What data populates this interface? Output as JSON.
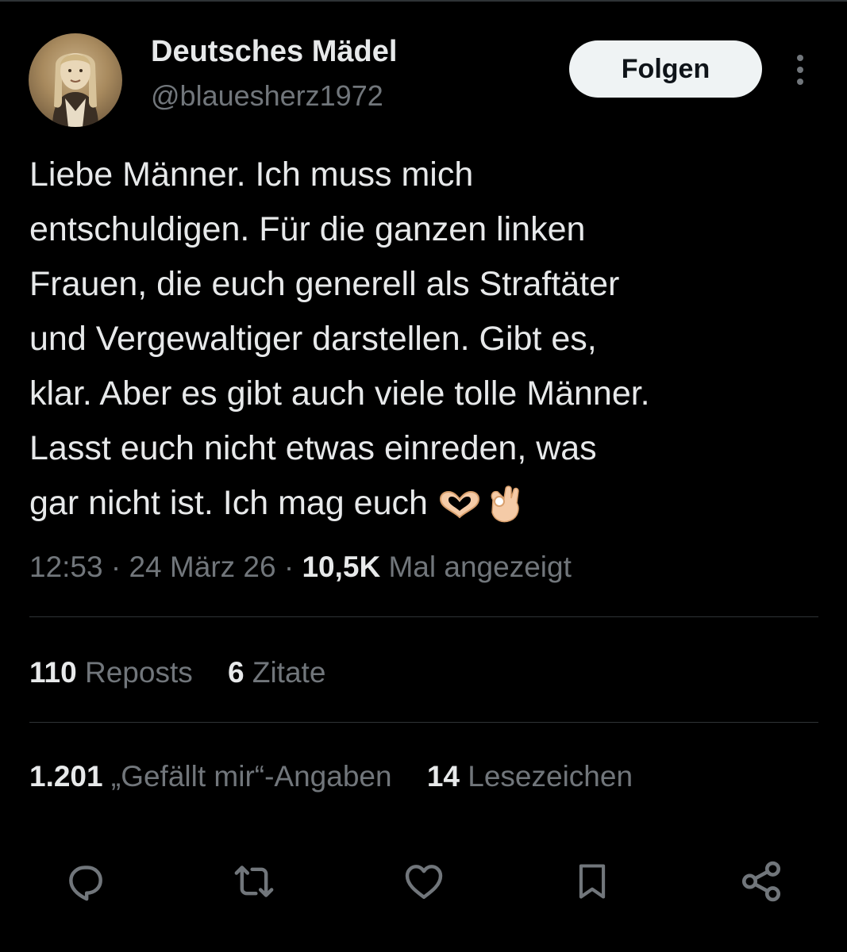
{
  "tweet": {
    "author": {
      "display_name": "Deutsches Mädel",
      "handle": "@blauesherz1972"
    },
    "follow_label": "Folgen",
    "more_icon": "more-vertical-icon",
    "text_lines": [
      "Liebe Männer. Ich muss mich",
      "entschuldigen. Für die ganzen linken",
      "Frauen, die euch generell als Straftäter",
      "und Vergewaltiger darstellen. Gibt es,",
      "klar. Aber es gibt auch viele tolle Männer.",
      "Lasst euch nicht etwas einreden, was",
      "gar nicht ist. Ich mag euch"
    ],
    "emojis": [
      "heart-hands-emoji",
      "ok-hand-emoji"
    ],
    "meta": {
      "time": "12:53",
      "separator": "·",
      "date": "24 März 26",
      "views_count": "10,5K",
      "views_label": "Mal angezeigt"
    },
    "stats": {
      "reposts_count": "110",
      "reposts_label": "Reposts",
      "quotes_count": "6",
      "quotes_label": "Zitate",
      "likes_count": "1.201",
      "likes_label": "„Gefällt mir“-Angaben",
      "bookmarks_count": "14",
      "bookmarks_label": "Lesezeichen"
    },
    "actions": [
      "reply-icon",
      "repost-icon",
      "like-icon",
      "bookmark-icon",
      "share-icon"
    ]
  },
  "colors": {
    "background": "#000000",
    "text_primary": "#e7e9ea",
    "text_secondary": "#71767b",
    "divider": "#2f3336",
    "button_bg": "#eff3f4",
    "button_text": "#0f1419"
  }
}
